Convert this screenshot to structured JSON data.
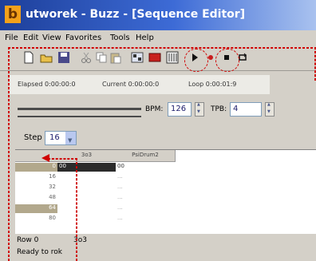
{
  "window": {
    "title": "utworek - Buzz - [Sequence Editor]",
    "app_icon_letter": "b"
  },
  "menu": [
    "File",
    "Edit",
    "View",
    "Favorites",
    "Tools",
    "Help"
  ],
  "toolbar": {
    "icons": [
      "new-icon",
      "open-icon",
      "save-icon",
      "cut-icon",
      "copy-icon",
      "paste-icon",
      "machines-icon",
      "patterns-icon",
      "sequence-editor-icon",
      "play-icon",
      "record-icon",
      "stop-icon",
      "loop-icon"
    ]
  },
  "status": {
    "elapsed": "Elapsed 0:00:00:0",
    "current": "Current 0:00:00:0",
    "loop": "Loop 0:00:01:9"
  },
  "controls": {
    "bpm_label": "BPM:",
    "bpm_value": "126",
    "tpb_label": "TPB:",
    "tpb_value": "4"
  },
  "step": {
    "label": "Step",
    "value": "16"
  },
  "grid": {
    "columns": [
      "3o3",
      "PsiDrum2"
    ],
    "rows": [
      {
        "label": "0",
        "cells": [
          "00",
          "00"
        ]
      },
      {
        "label": "16",
        "cells": [
          "",
          "..."
        ]
      },
      {
        "label": "32",
        "cells": [
          "",
          "..."
        ]
      },
      {
        "label": "48",
        "cells": [
          "",
          "..."
        ]
      },
      {
        "label": "64",
        "cells": [
          "",
          "..."
        ]
      },
      {
        "label": "80",
        "cells": [
          "",
          "..."
        ]
      }
    ]
  },
  "statusbar": {
    "row": "Row 0",
    "machine": "3o3",
    "ready": "Ready to rok"
  },
  "colors": {
    "annotation": "#d00000",
    "highlight_row": "#2b2b2b",
    "row_label_tan": "#b2a88c"
  }
}
